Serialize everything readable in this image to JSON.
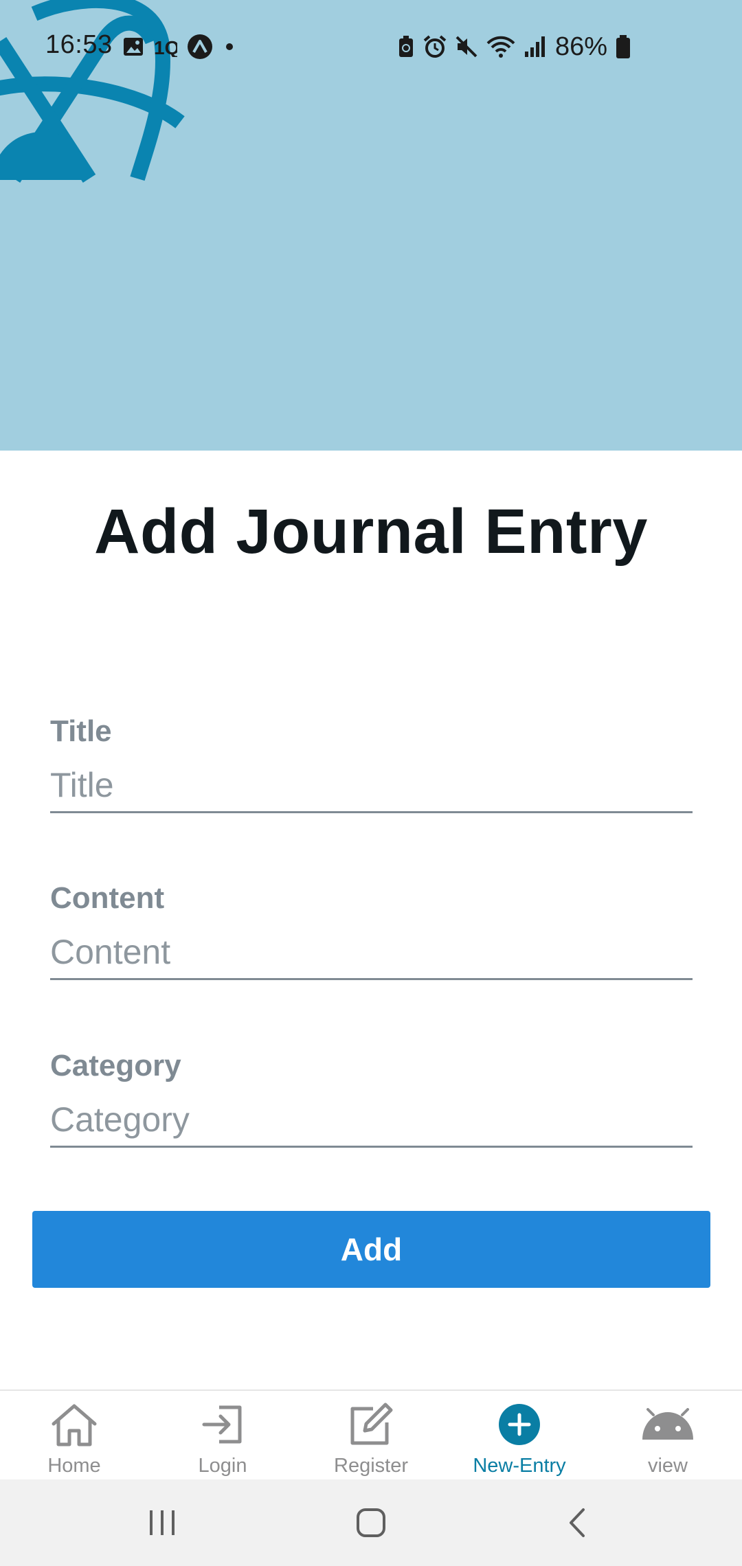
{
  "status_bar": {
    "time": "16:53",
    "battery_percent": "86%",
    "left_icons": [
      "gallery-icon",
      "app-notification-icon",
      "expo-icon",
      "dot-icon"
    ],
    "right_icons": [
      "battery-saver-icon",
      "alarm-icon",
      "mute-icon",
      "wifi-icon",
      "signal-icon",
      "battery-icon"
    ]
  },
  "header": {
    "background_color": "#a1cedf",
    "logo_color": "#0a84b0"
  },
  "page": {
    "title": "Add Journal Entry"
  },
  "form": {
    "title": {
      "label": "Title",
      "placeholder": "Title",
      "value": ""
    },
    "content": {
      "label": "Content",
      "placeholder": "Content",
      "value": ""
    },
    "category": {
      "label": "Category",
      "placeholder": "Category",
      "value": ""
    },
    "submit_label": "Add",
    "submit_color": "#2287da"
  },
  "tab_bar": {
    "active_color": "#0a7ea4",
    "inactive_color": "#8e8e8f",
    "tabs": [
      {
        "label": "Home",
        "icon": "home-icon",
        "active": false
      },
      {
        "label": "Login",
        "icon": "login-icon",
        "active": false
      },
      {
        "label": "Register",
        "icon": "edit-icon",
        "active": false
      },
      {
        "label": "New-Entry",
        "icon": "plus-circle-icon",
        "active": true
      },
      {
        "label": "view",
        "icon": "android-icon",
        "active": false
      }
    ]
  },
  "nav_bar": {
    "buttons": [
      "recents-icon",
      "home-icon",
      "back-icon"
    ]
  }
}
